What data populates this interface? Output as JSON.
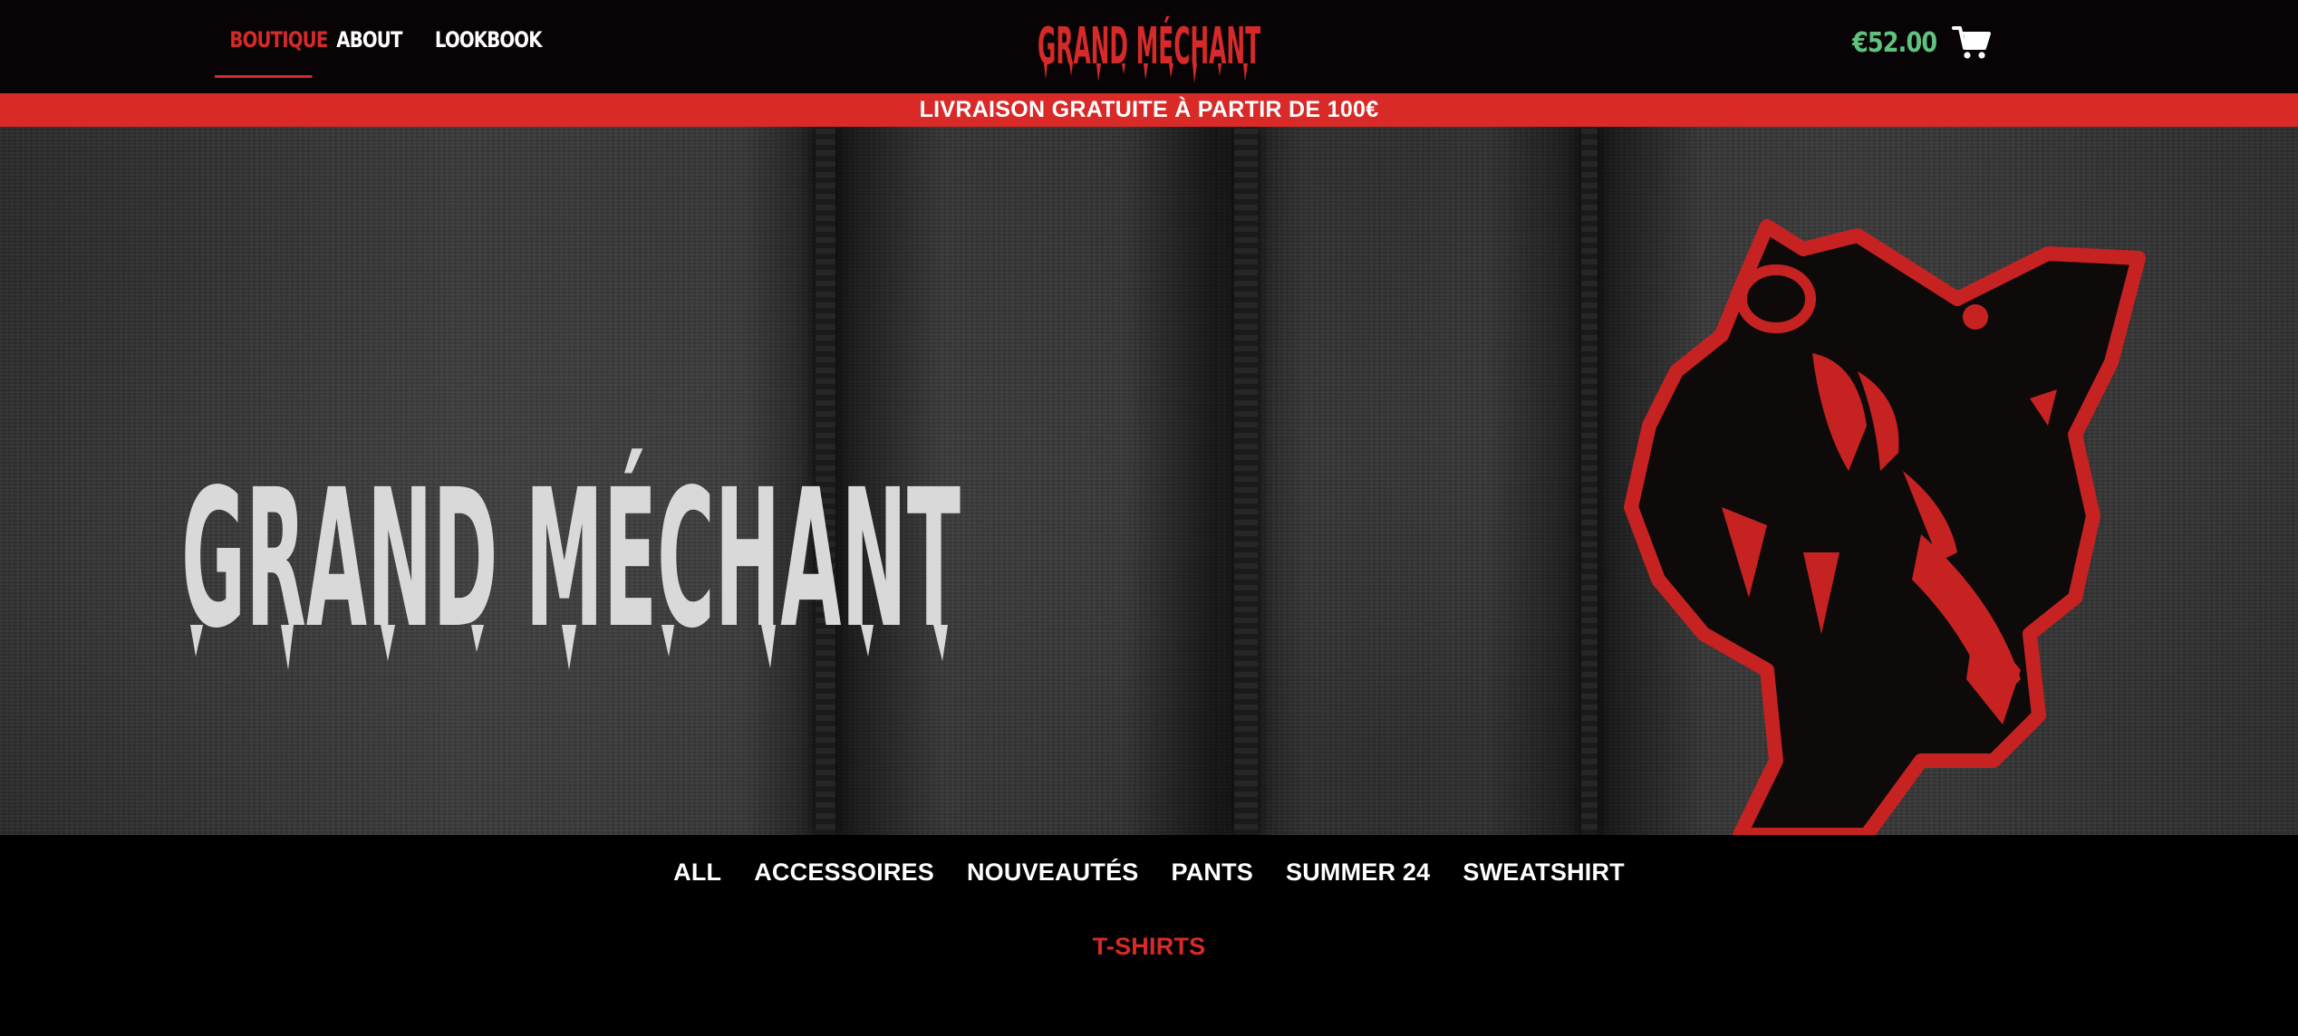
{
  "header": {
    "nav": [
      {
        "label": "BOUTIQUE",
        "active": true
      },
      {
        "label": "ABOUT",
        "active": false
      },
      {
        "label": "LOOKBOOK",
        "active": false
      }
    ],
    "logo_text": "GRAND MÉCHANT",
    "cart_total": "€52.00",
    "cart_icon": "shopping-cart-icon"
  },
  "banner": {
    "text": "LIVRAISON GRATUITE À PARTIR DE 100€"
  },
  "hero": {
    "print_text": "GRAND MÉCHANT",
    "image_subject": "Dark grey hoodie with white 'GRAND MÉCHANT' print and red wolf graphic"
  },
  "categories": {
    "row1": [
      "ALL",
      "ACCESSOIRES",
      "NOUVEAUTÉS",
      "PANTS",
      "SUMMER 24",
      "SWEATSHIRT"
    ],
    "row2": [
      "T-SHIRTS"
    ],
    "active": "T-SHIRTS"
  },
  "colors": {
    "header_bg": "#080304",
    "accent_red": "#d92a27",
    "cart_green": "#5fc27e",
    "page_bg": "#000000"
  }
}
